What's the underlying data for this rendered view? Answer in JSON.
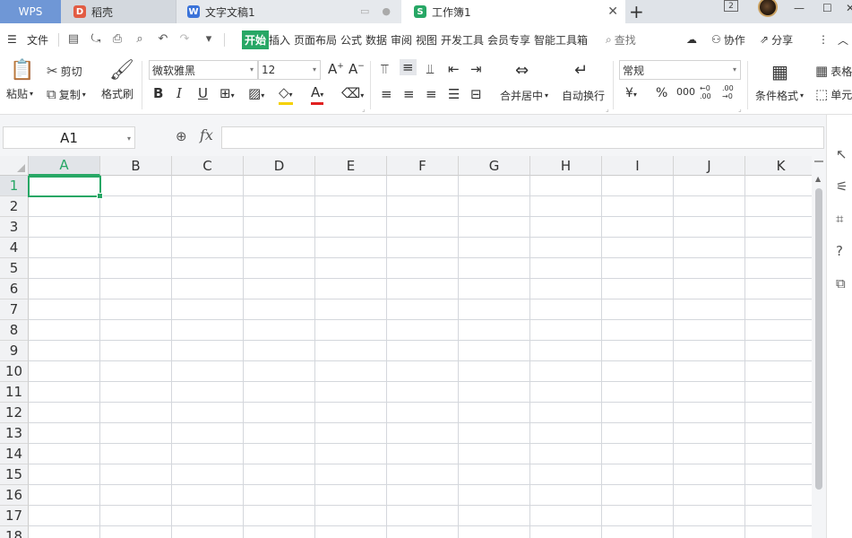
{
  "tabs": {
    "wps": "WPS",
    "daoke": "稻壳",
    "doc": "文字文稿1",
    "book": "工作簿1",
    "doc_badge": "W",
    "book_badge": "S",
    "daoke_badge": "D"
  },
  "window": {
    "tab_count": "2"
  },
  "menu": {
    "file": "文件",
    "items": [
      "开始",
      "插入",
      "页面布局",
      "公式",
      "数据",
      "审阅",
      "视图",
      "开发工具",
      "会员专享",
      "智能工具箱"
    ],
    "search": "查找",
    "collab": "协作",
    "share": "分享"
  },
  "ribbon": {
    "paste": "粘贴",
    "cut": "剪切",
    "copy": "复制",
    "format_painter": "格式刷",
    "font_name": "微软雅黑",
    "font_size": "12",
    "bold": "B",
    "italic": "I",
    "underline": "U",
    "merge_center": "合并居中",
    "wrap_text": "自动换行",
    "number_format": "常规",
    "currency": "¥",
    "percent": "%",
    "thousands": "000",
    "dec_inc": "←0\n.00",
    "dec_dec": ".00\n→0",
    "cond_format": "条件格式",
    "table_style": "表格",
    "cell": "单元"
  },
  "formula_bar": {
    "name_box": "A1",
    "fx": "fx",
    "value": ""
  },
  "grid": {
    "columns": [
      "A",
      "B",
      "C",
      "D",
      "E",
      "F",
      "G",
      "H",
      "I",
      "J",
      "K"
    ],
    "rows": [
      "1",
      "2",
      "3",
      "4",
      "5",
      "6",
      "7",
      "8",
      "9",
      "10",
      "11",
      "12",
      "13",
      "14",
      "15",
      "16",
      "17",
      "18"
    ],
    "selected_cell": "A1"
  },
  "colors": {
    "accent": "#27a765",
    "wps_tab": "#6f97d6"
  }
}
